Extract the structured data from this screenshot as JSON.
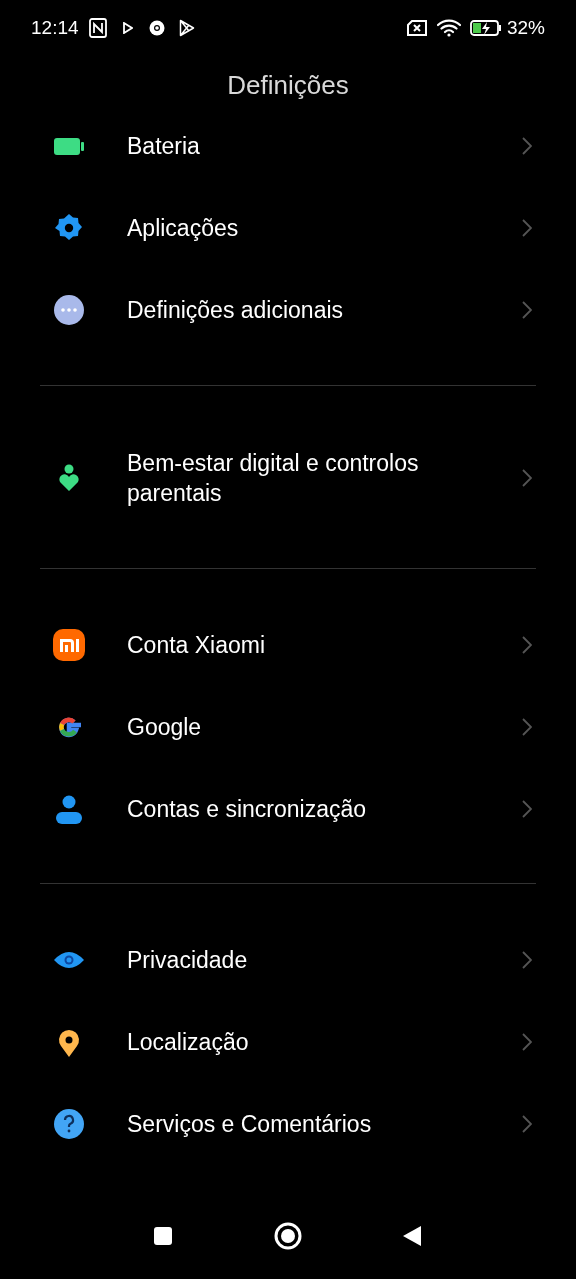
{
  "status_bar": {
    "time": "12:14",
    "battery_percent": "32%"
  },
  "title": "Definições",
  "groups": [
    {
      "items": [
        {
          "label": "Bateria"
        },
        {
          "label": "Aplicações"
        },
        {
          "label": "Definições adicionais"
        }
      ]
    },
    {
      "items": [
        {
          "label": "Bem-estar digital e controlos parentais"
        }
      ]
    },
    {
      "items": [
        {
          "label": "Conta Xiaomi"
        },
        {
          "label": "Google"
        },
        {
          "label": "Contas e sincronização"
        }
      ]
    },
    {
      "items": [
        {
          "label": "Privacidade"
        },
        {
          "label": "Localização"
        },
        {
          "label": "Serviços e Comentários"
        }
      ]
    }
  ]
}
